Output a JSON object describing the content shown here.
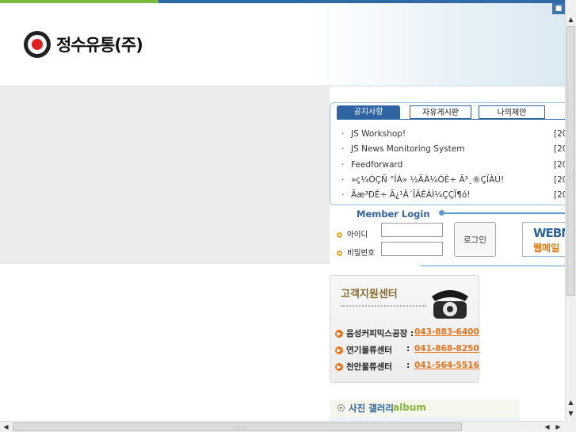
{
  "header": {
    "logo_text": "정수유통(주)"
  },
  "tabs": [
    {
      "label": "공지사항"
    },
    {
      "label": "자유게시판"
    },
    {
      "label": "나의제안"
    }
  ],
  "notices": [
    {
      "title": "JS Workshop!",
      "date": "[20"
    },
    {
      "title": "JS News Monitoring System",
      "date": "[20"
    },
    {
      "title": "Feedforward",
      "date": "[20"
    },
    {
      "title": "»ç¼ÒÇÑ °ÍÀ» ½ÃÀ¼ÒÈ÷ Ã³¸®ÇÏÀÚ!",
      "date": "[20"
    },
    {
      "title": "Ãæ³ÐÈ÷ Ã¿¹Â´ÏÄÉÀÌ¼ÇÇÏ¶ó!",
      "date": "[20"
    }
  ],
  "login": {
    "title": "Member  Login",
    "id_label": "아이디",
    "pw_label": "비밀번호",
    "button": "로그인",
    "webmail_en": "WEBM",
    "webmail_kr": "웹메일"
  },
  "customer_support": {
    "title": "고객지원센터",
    "centers": [
      {
        "name": "음성커피믹스공장 :",
        "phone": "043-883-6400"
      },
      {
        "name": "연기물류센터",
        "colon": ":",
        "phone": "041-868-8250"
      },
      {
        "name": "천안물류센터",
        "colon": ":",
        "phone": "041-564-5516"
      }
    ]
  },
  "gallery": {
    "title_kr": "사진 갤러리",
    "title_en": "album"
  },
  "colors": {
    "accent_blue": "#2f63a2",
    "accent_orange": "#e8731a",
    "accent_green": "#86b53c"
  }
}
